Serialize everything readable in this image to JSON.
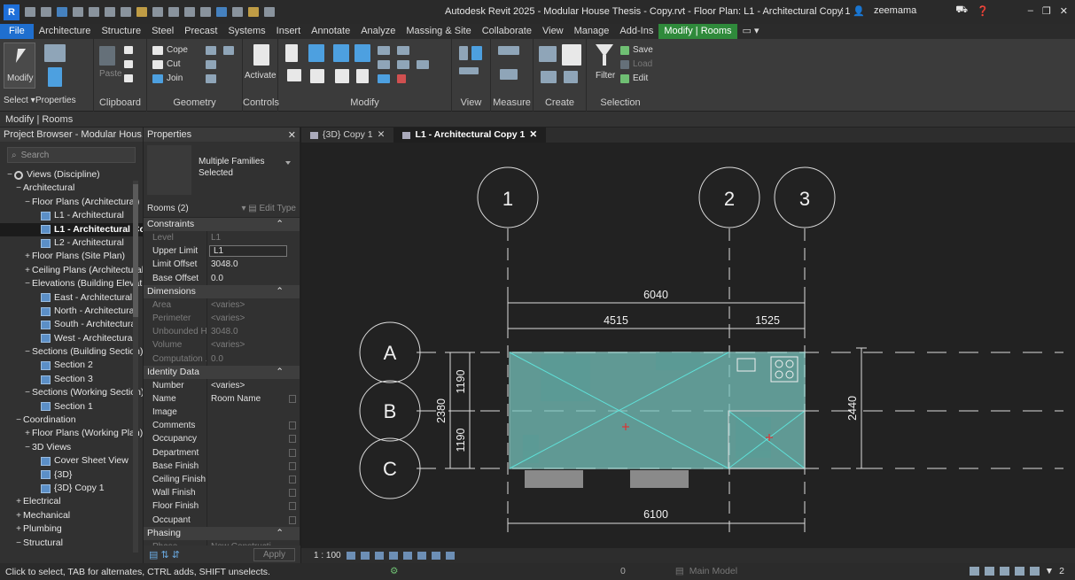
{
  "title": "Autodesk Revit 2025 - Modular House Thesis - Copy.rvt - Floor Plan: L1 - Architectural Copy 1",
  "titlebar_right": {
    "user": "zeemama"
  },
  "ribbon_tabs": [
    "File",
    "Architecture",
    "Structure",
    "Steel",
    "Precast",
    "Systems",
    "Insert",
    "Annotate",
    "Analyze",
    "Massing & Site",
    "Collaborate",
    "View",
    "Manage",
    "Add-Ins",
    "Modify | Rooms"
  ],
  "ribbon": {
    "modify_label": "Modify",
    "select_label": "Select",
    "properties_panel": "Properties",
    "clipboard_panel": "Clipboard",
    "paste_label": "Paste",
    "geometry_panel": "Geometry",
    "cope_label": "Cope",
    "cut_label": "Cut",
    "join_label": "Join",
    "controls_panel": "Controls",
    "activate_label": "Activate",
    "modify_panel": "Modify",
    "view_panel": "View",
    "measure_panel": "Measure",
    "create_panel": "Create",
    "selection_panel": "Selection",
    "filter_label": "Filter",
    "save_label": "Save",
    "load_label": "Load",
    "edit_label": "Edit"
  },
  "context_bar": "Modify | Rooms",
  "project_browser": {
    "title": "Project Browser - Modular Hous...",
    "search_placeholder": "Search",
    "items": [
      {
        "label": "Views (Discipline)",
        "level": 0,
        "exp": "−",
        "icon": "eye"
      },
      {
        "label": "Architectural",
        "level": 1,
        "exp": "−"
      },
      {
        "label": "Floor Plans (Architectural)",
        "level": 2,
        "exp": "−"
      },
      {
        "label": "L1 - Architectural",
        "level": 3,
        "icon": "view"
      },
      {
        "label": "L1 - Architectural Copy 1",
        "level": 3,
        "icon": "view",
        "selected": true
      },
      {
        "label": "L2 - Architectural",
        "level": 3,
        "icon": "view"
      },
      {
        "label": "Floor Plans (Site Plan)",
        "level": 2,
        "exp": "+"
      },
      {
        "label": "Ceiling Plans (Architectural)",
        "level": 2,
        "exp": "+"
      },
      {
        "label": "Elevations (Building Elevation)",
        "level": 2,
        "exp": "−"
      },
      {
        "label": "East - Architectural",
        "level": 3,
        "icon": "view"
      },
      {
        "label": "North - Architectural",
        "level": 3,
        "icon": "view"
      },
      {
        "label": "South - Architectural",
        "level": 3,
        "icon": "view"
      },
      {
        "label": "West - Architectural",
        "level": 3,
        "icon": "view"
      },
      {
        "label": "Sections (Building Section)",
        "level": 2,
        "exp": "−"
      },
      {
        "label": "Section 2",
        "level": 3,
        "icon": "view"
      },
      {
        "label": "Section 3",
        "level": 3,
        "icon": "view"
      },
      {
        "label": "Sections (Working Section)",
        "level": 2,
        "exp": "−"
      },
      {
        "label": "Section 1",
        "level": 3,
        "icon": "view"
      },
      {
        "label": "Coordination",
        "level": 1,
        "exp": "−"
      },
      {
        "label": "Floor Plans (Working Plan)",
        "level": 2,
        "exp": "+"
      },
      {
        "label": "3D Views",
        "level": 2,
        "exp": "−"
      },
      {
        "label": "Cover Sheet View",
        "level": 3,
        "icon": "view"
      },
      {
        "label": "{3D}",
        "level": 3,
        "icon": "view"
      },
      {
        "label": "{3D} Copy 1",
        "level": 3,
        "icon": "view"
      },
      {
        "label": "Electrical",
        "level": 1,
        "exp": "+"
      },
      {
        "label": "Mechanical",
        "level": 1,
        "exp": "+"
      },
      {
        "label": "Plumbing",
        "level": 1,
        "exp": "+"
      },
      {
        "label": "Structural",
        "level": 1,
        "exp": "−"
      }
    ]
  },
  "properties": {
    "title": "Properties",
    "type_name": "Multiple Families Selected",
    "instance_filter": "Rooms (2)",
    "edit_type": "Edit Type",
    "apply": "Apply",
    "sections": [
      {
        "name": "Constraints",
        "rows": [
          {
            "k": "Level",
            "v": "L1",
            "dim": true
          },
          {
            "k": "Upper Limit",
            "v": "L1",
            "box": true
          },
          {
            "k": "Limit Offset",
            "v": "3048.0"
          },
          {
            "k": "Base Offset",
            "v": "0.0"
          }
        ]
      },
      {
        "name": "Dimensions",
        "rows": [
          {
            "k": "Area",
            "v": "<varies>",
            "dim": true
          },
          {
            "k": "Perimeter",
            "v": "<varies>",
            "dim": true
          },
          {
            "k": "Unbounded H...",
            "v": "3048.0",
            "dim": true
          },
          {
            "k": "Volume",
            "v": "<varies>",
            "dim": true
          },
          {
            "k": "Computation ...",
            "v": "0.0",
            "dim": true
          }
        ]
      },
      {
        "name": "Identity Data",
        "rows": [
          {
            "k": "Number",
            "v": "<varies>"
          },
          {
            "k": "Name",
            "v": "Room Name",
            "cb": true
          },
          {
            "k": "Image",
            "v": ""
          },
          {
            "k": "Comments",
            "v": "",
            "cb": true
          },
          {
            "k": "Occupancy",
            "v": "",
            "cb": true
          },
          {
            "k": "Department",
            "v": "",
            "cb": true
          },
          {
            "k": "Base Finish",
            "v": "",
            "cb": true
          },
          {
            "k": "Ceiling Finish",
            "v": "",
            "cb": true
          },
          {
            "k": "Wall Finish",
            "v": "",
            "cb": true
          },
          {
            "k": "Floor Finish",
            "v": "",
            "cb": true
          },
          {
            "k": "Occupant",
            "v": "",
            "cb": true
          }
        ]
      },
      {
        "name": "Phasing",
        "rows": [
          {
            "k": "Phase",
            "v": "New Constructi...",
            "dim": true
          }
        ]
      }
    ]
  },
  "doc_tabs": [
    {
      "label": "{3D} Copy 1",
      "active": false
    },
    {
      "label": "L1 - Architectural Copy 1",
      "active": true
    }
  ],
  "drawing": {
    "grid_v": [
      "1",
      "2",
      "3"
    ],
    "grid_h": [
      "A",
      "B",
      "C"
    ],
    "dims": {
      "overall_top": "6040",
      "left_top": "4515",
      "right_top": "1525",
      "bottom": "6100",
      "left_total": "2380",
      "left_upper": "1190",
      "left_lower": "1190",
      "right": "2440"
    },
    "room_fill": "#79c7c1"
  },
  "view_bar": {
    "scale": "1 : 100"
  },
  "status": {
    "hint": "Click to select, TAB for alternates, CTRL adds, SHIFT unselects.",
    "workset_count": "0",
    "model": "Main Model",
    "filter_count": "2"
  }
}
